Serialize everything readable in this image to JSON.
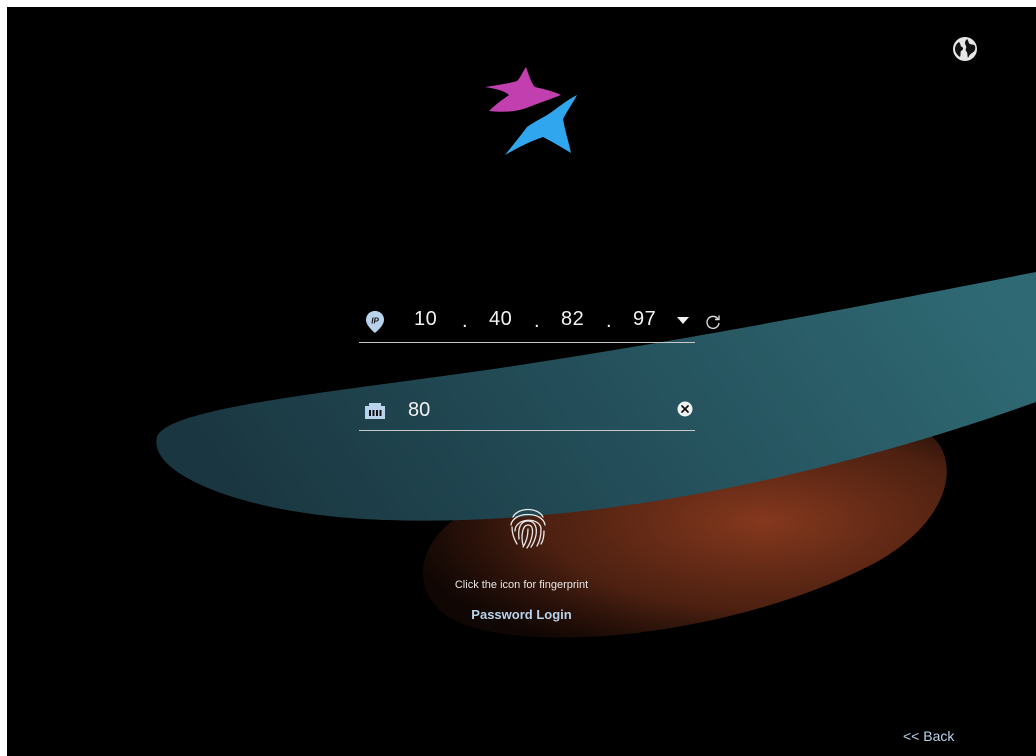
{
  "icons": {
    "language": "globe-icon",
    "logo": "star-logo-icon",
    "ip": "ip-location-pin-icon",
    "port": "network-port-icon",
    "dropdown": "caret-down-icon",
    "refresh": "refresh-icon",
    "clear": "clear-circle-x-icon",
    "fingerprint": "fingerprint-icon"
  },
  "colors": {
    "background": "#000000",
    "logo_magenta": "#c13fae",
    "logo_blue": "#2fa6ee",
    "teal_wave": "#2a5560",
    "orange_wave": "#8c3b1f",
    "link": "#b9d3ec",
    "text": "#f2f2f2"
  },
  "ip_address": {
    "octet1": "10",
    "octet2": "40",
    "octet3": "82",
    "octet4": "97",
    "separator": "."
  },
  "port": {
    "value": "80"
  },
  "fingerprint_hint": "Click the icon for fingerprint",
  "password_login_label": "Password Login",
  "back_label": "<< Back"
}
